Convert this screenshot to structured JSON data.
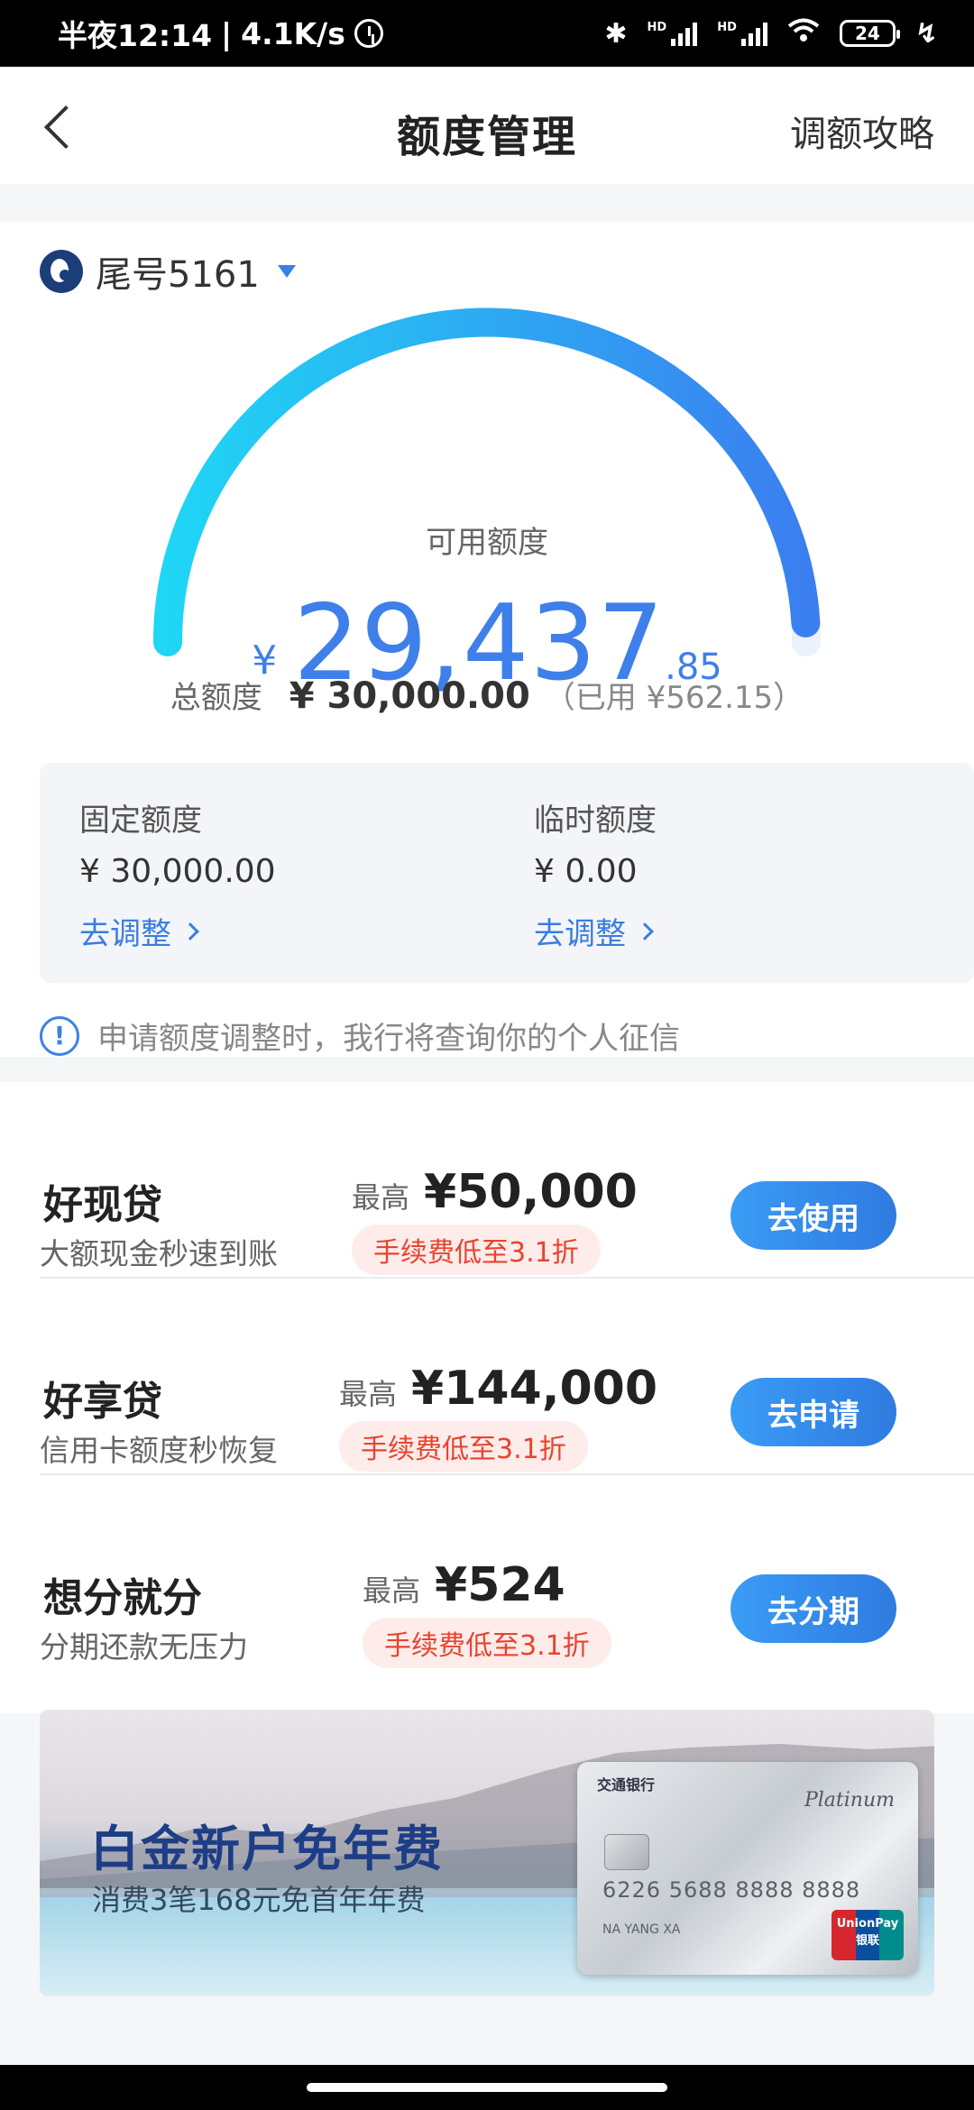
{
  "status_bar": {
    "time": "半夜12:14",
    "speed": "4.1K/s",
    "signal1_label": "HD",
    "signal2_label": "HD",
    "battery": "24"
  },
  "header": {
    "title": "额度管理",
    "right_link": "调额攻略"
  },
  "card": {
    "selector_label": "尾号5161",
    "available_label": "可用额度",
    "currency": "¥",
    "available_int": "29,437",
    "available_dec": ".85",
    "total_label": "总额度",
    "total_value": "¥ 30,000.00",
    "used_text": "（已用 ¥562.15）"
  },
  "quotas": [
    {
      "label": "固定额度",
      "value": "¥ 30,000.00",
      "link": "去调整"
    },
    {
      "label": "临时额度",
      "value": "¥ 0.00",
      "link": "去调整"
    }
  ],
  "notice": "申请额度调整时，我行将查询你的个人征信",
  "loans": [
    {
      "name": "好现贷",
      "desc": "大额现金秒速到账",
      "max_label": "最高",
      "max_value": "¥50,000",
      "fee": "手续费低至3.1折",
      "button": "去使用"
    },
    {
      "name": "好享贷",
      "desc": "信用卡额度秒恢复",
      "max_label": "最高",
      "max_value": "¥144,000",
      "fee": "手续费低至3.1折",
      "button": "去申请"
    },
    {
      "name": "想分就分",
      "desc": "分期还款无压力",
      "max_label": "最高",
      "max_value": "¥524",
      "fee": "手续费低至3.1折",
      "button": "去分期"
    }
  ],
  "banner": {
    "title": "白金新户免年费",
    "subtitle": "消费3笔168元免首年年费",
    "card_bank": "交通银行",
    "card_tier": "Platinum",
    "card_number": "6226 5688 8888 8888",
    "card_holder": "NA YANG XA",
    "card_network": "UnionPay 银联"
  },
  "colors": {
    "accent": "#3f7fe9",
    "gauge_start": "#1fd6f5",
    "gauge_end": "#3b7ef0",
    "fee_text": "#e8432f",
    "fee_bg": "#fdecea",
    "banner_title": "#1d3e86"
  },
  "gauge": {
    "available_ratio": 0.981
  }
}
